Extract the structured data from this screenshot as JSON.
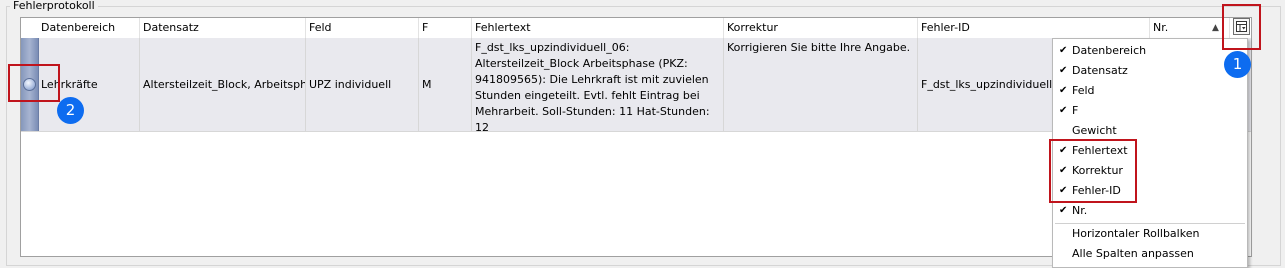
{
  "group": {
    "title": "Fehlerprotokoll"
  },
  "columns": {
    "datenbereich": "Datenbereich",
    "datensatz": "Datensatz",
    "feld": "Feld",
    "f": "F",
    "fehlertext": "Fehlertext",
    "korrektur": "Korrektur",
    "fehler_id": "Fehler-ID",
    "nr": "Nr."
  },
  "sort_indicator": "▲",
  "row": {
    "datenbereich": "Lehrkräfte",
    "datensatz": "Altersteilzeit_Block, Arbeitsph...",
    "feld": "UPZ individuell",
    "f": "M",
    "fehlertext": "F_dst_lks_upzindividuell_06: Altersteilzeit_Block Arbeitsphase (PKZ: 941809565): Die Lehrkraft ist mit zuvielen Stunden eingeteilt. Evtl. fehlt Eintrag bei Mehrarbeit. Soll-Stunden: 11 Hat-Stunden: 12",
    "korrektur": "Korrigieren Sie bitte Ihre Angabe.",
    "fehler_id": "F_dst_lks_upzindividuell_0"
  },
  "column_chooser": {
    "button_icon": "column-chooser-icon",
    "items": [
      {
        "label": "Datenbereich",
        "checked": true
      },
      {
        "label": "Datensatz",
        "checked": true
      },
      {
        "label": "Feld",
        "checked": true
      },
      {
        "label": "F",
        "checked": true
      },
      {
        "label": "Gewicht",
        "checked": false
      },
      {
        "label": "Fehlertext",
        "checked": true
      },
      {
        "label": "Korrektur",
        "checked": true
      },
      {
        "label": "Fehler-ID",
        "checked": true
      },
      {
        "label": "Nr.",
        "checked": true
      },
      {
        "label": "Horizontaler Rollbalken",
        "checked": false
      },
      {
        "label": "Alle Spalten anpassen",
        "checked": false
      }
    ]
  },
  "annotations": {
    "badge1": "1",
    "badge2": "2",
    "color": "#c0141c",
    "badge_color": "#0d6cf0"
  }
}
